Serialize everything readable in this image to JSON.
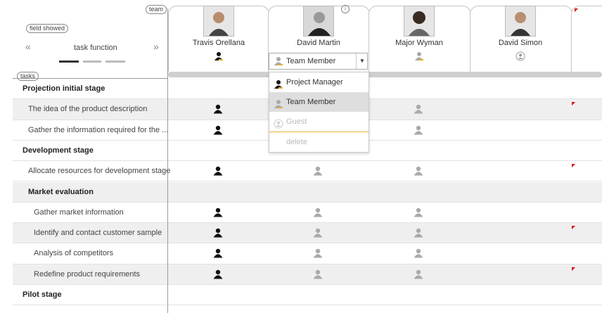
{
  "header": {
    "team_label": "team",
    "field_showed_label": "field showed",
    "task_function_label": "task function",
    "prev_arrow": "«",
    "next_arrow": "»",
    "tasks_label": "tasks"
  },
  "members": [
    {
      "name": "Travis Orellana",
      "role_icon": "project-manager-icon"
    },
    {
      "name": "David Martin",
      "role_icon": "team-member-icon",
      "info": "i"
    },
    {
      "name": "Major Wyman",
      "role_icon": "team-member-icon"
    },
    {
      "name": "David Simon",
      "role_icon": "guest-icon"
    }
  ],
  "role_select": {
    "selected": "Team Member",
    "options": [
      "Project Manager",
      "Team Member",
      "Guest",
      "delete"
    ]
  },
  "rows": [
    {
      "label": "Projection initial stage",
      "kind": "section"
    },
    {
      "label": "The idea of the product description",
      "kind": "task"
    },
    {
      "label": "Gather the information required for the ...",
      "kind": "task"
    },
    {
      "label": "Development stage",
      "kind": "section"
    },
    {
      "label": "Allocate resources for development stage",
      "kind": "task"
    },
    {
      "label": "Market evaluation",
      "kind": "sub"
    },
    {
      "label": "Gather market information",
      "kind": "task2"
    },
    {
      "label": "Identify and contact customer sample",
      "kind": "task2"
    },
    {
      "label": "Analysis of competitors",
      "kind": "task2"
    },
    {
      "label": "Redefine product requirements",
      "kind": "task2"
    },
    {
      "label": "Pilot stage",
      "kind": "section"
    }
  ],
  "colors": {
    "pm": "#111111",
    "member": "#a9a9a9",
    "accent": "#e8b030",
    "flag": "#dd0000"
  }
}
